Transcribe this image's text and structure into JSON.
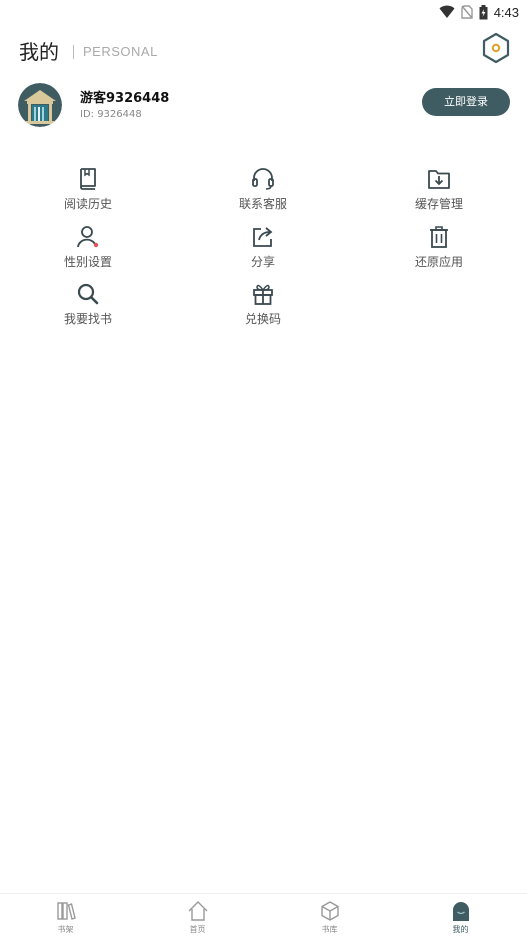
{
  "status_bar": {
    "time": "4:43"
  },
  "header": {
    "title": "我的",
    "subtitle": "PERSONAL"
  },
  "profile": {
    "username": "游客9326448",
    "user_id": "ID: 9326448",
    "login_label": "立即登录"
  },
  "menu": {
    "items": [
      {
        "label": "阅读历史",
        "icon": "book-icon"
      },
      {
        "label": "联系客服",
        "icon": "headset-icon"
      },
      {
        "label": "缓存管理",
        "icon": "folder-download-icon"
      },
      {
        "label": "性别设置",
        "icon": "user-icon"
      },
      {
        "label": "分享",
        "icon": "share-icon"
      },
      {
        "label": "还原应用",
        "icon": "trash-icon"
      },
      {
        "label": "我要找书",
        "icon": "search-icon"
      },
      {
        "label": "兑换码",
        "icon": "gift-icon"
      }
    ]
  },
  "tabbar": {
    "items": [
      {
        "label": "书架",
        "icon": "bookshelf-icon"
      },
      {
        "label": "首页",
        "icon": "home-icon"
      },
      {
        "label": "书库",
        "icon": "cube-icon"
      },
      {
        "label": "我的",
        "icon": "profile-icon"
      }
    ],
    "active_index": 3
  },
  "colors": {
    "accent": "#3f5c62",
    "icon": "#3a4a50",
    "label": "#555555"
  }
}
